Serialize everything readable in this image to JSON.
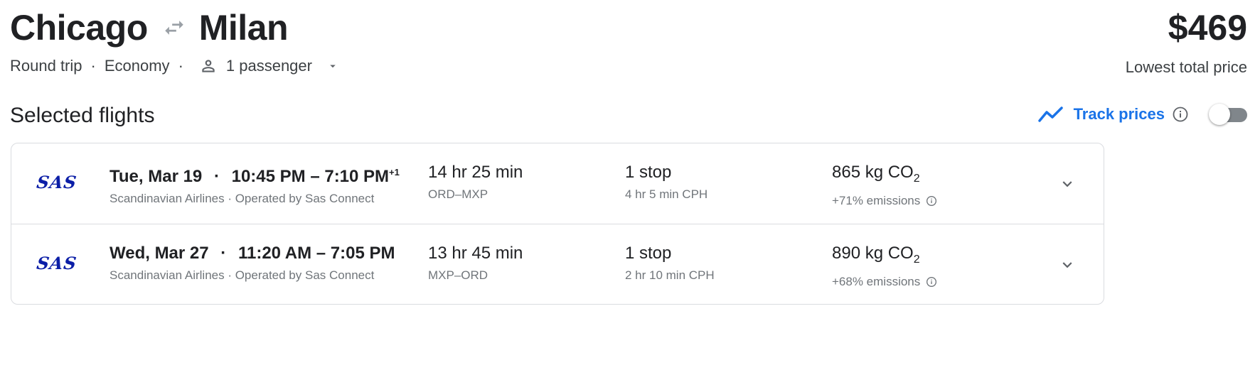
{
  "route": {
    "origin": "Chicago",
    "destination": "Milan"
  },
  "price": {
    "amount": "$469",
    "label": "Lowest total price"
  },
  "trip_options": {
    "trip_type": "Round trip",
    "cabin": "Economy",
    "separator": "·",
    "passengers": "1 passenger"
  },
  "section_title": "Selected flights",
  "track_prices": {
    "label": "Track prices",
    "enabled": false,
    "accent": "#1a73e8"
  },
  "flights": [
    {
      "airline_logo": "SAS",
      "date": "Tue, Mar 19",
      "times": "10:45 PM – 7:10 PM",
      "day_offset": "+1",
      "airline": "Scandinavian Airlines · Operated by Sas Connect",
      "duration": "14 hr 25 min",
      "route": "ORD–MXP",
      "stops": "1 stop",
      "layover": "4 hr 5 min CPH",
      "co2": "865 kg CO",
      "co2_sub": "2",
      "emissions": "+71% emissions"
    },
    {
      "airline_logo": "SAS",
      "date": "Wed, Mar 27",
      "times": "11:20 AM – 7:05 PM",
      "day_offset": "",
      "airline": "Scandinavian Airlines · Operated by Sas Connect",
      "duration": "13 hr 45 min",
      "route": "MXP–ORD",
      "stops": "1 stop",
      "layover": "2 hr 10 min CPH",
      "co2": "890 kg CO",
      "co2_sub": "2",
      "emissions": "+68% emissions"
    }
  ],
  "colors": {
    "text": "#202124",
    "secondary": "#70757a",
    "border": "#dadce0",
    "sas_blue": "#0b1ea7"
  }
}
